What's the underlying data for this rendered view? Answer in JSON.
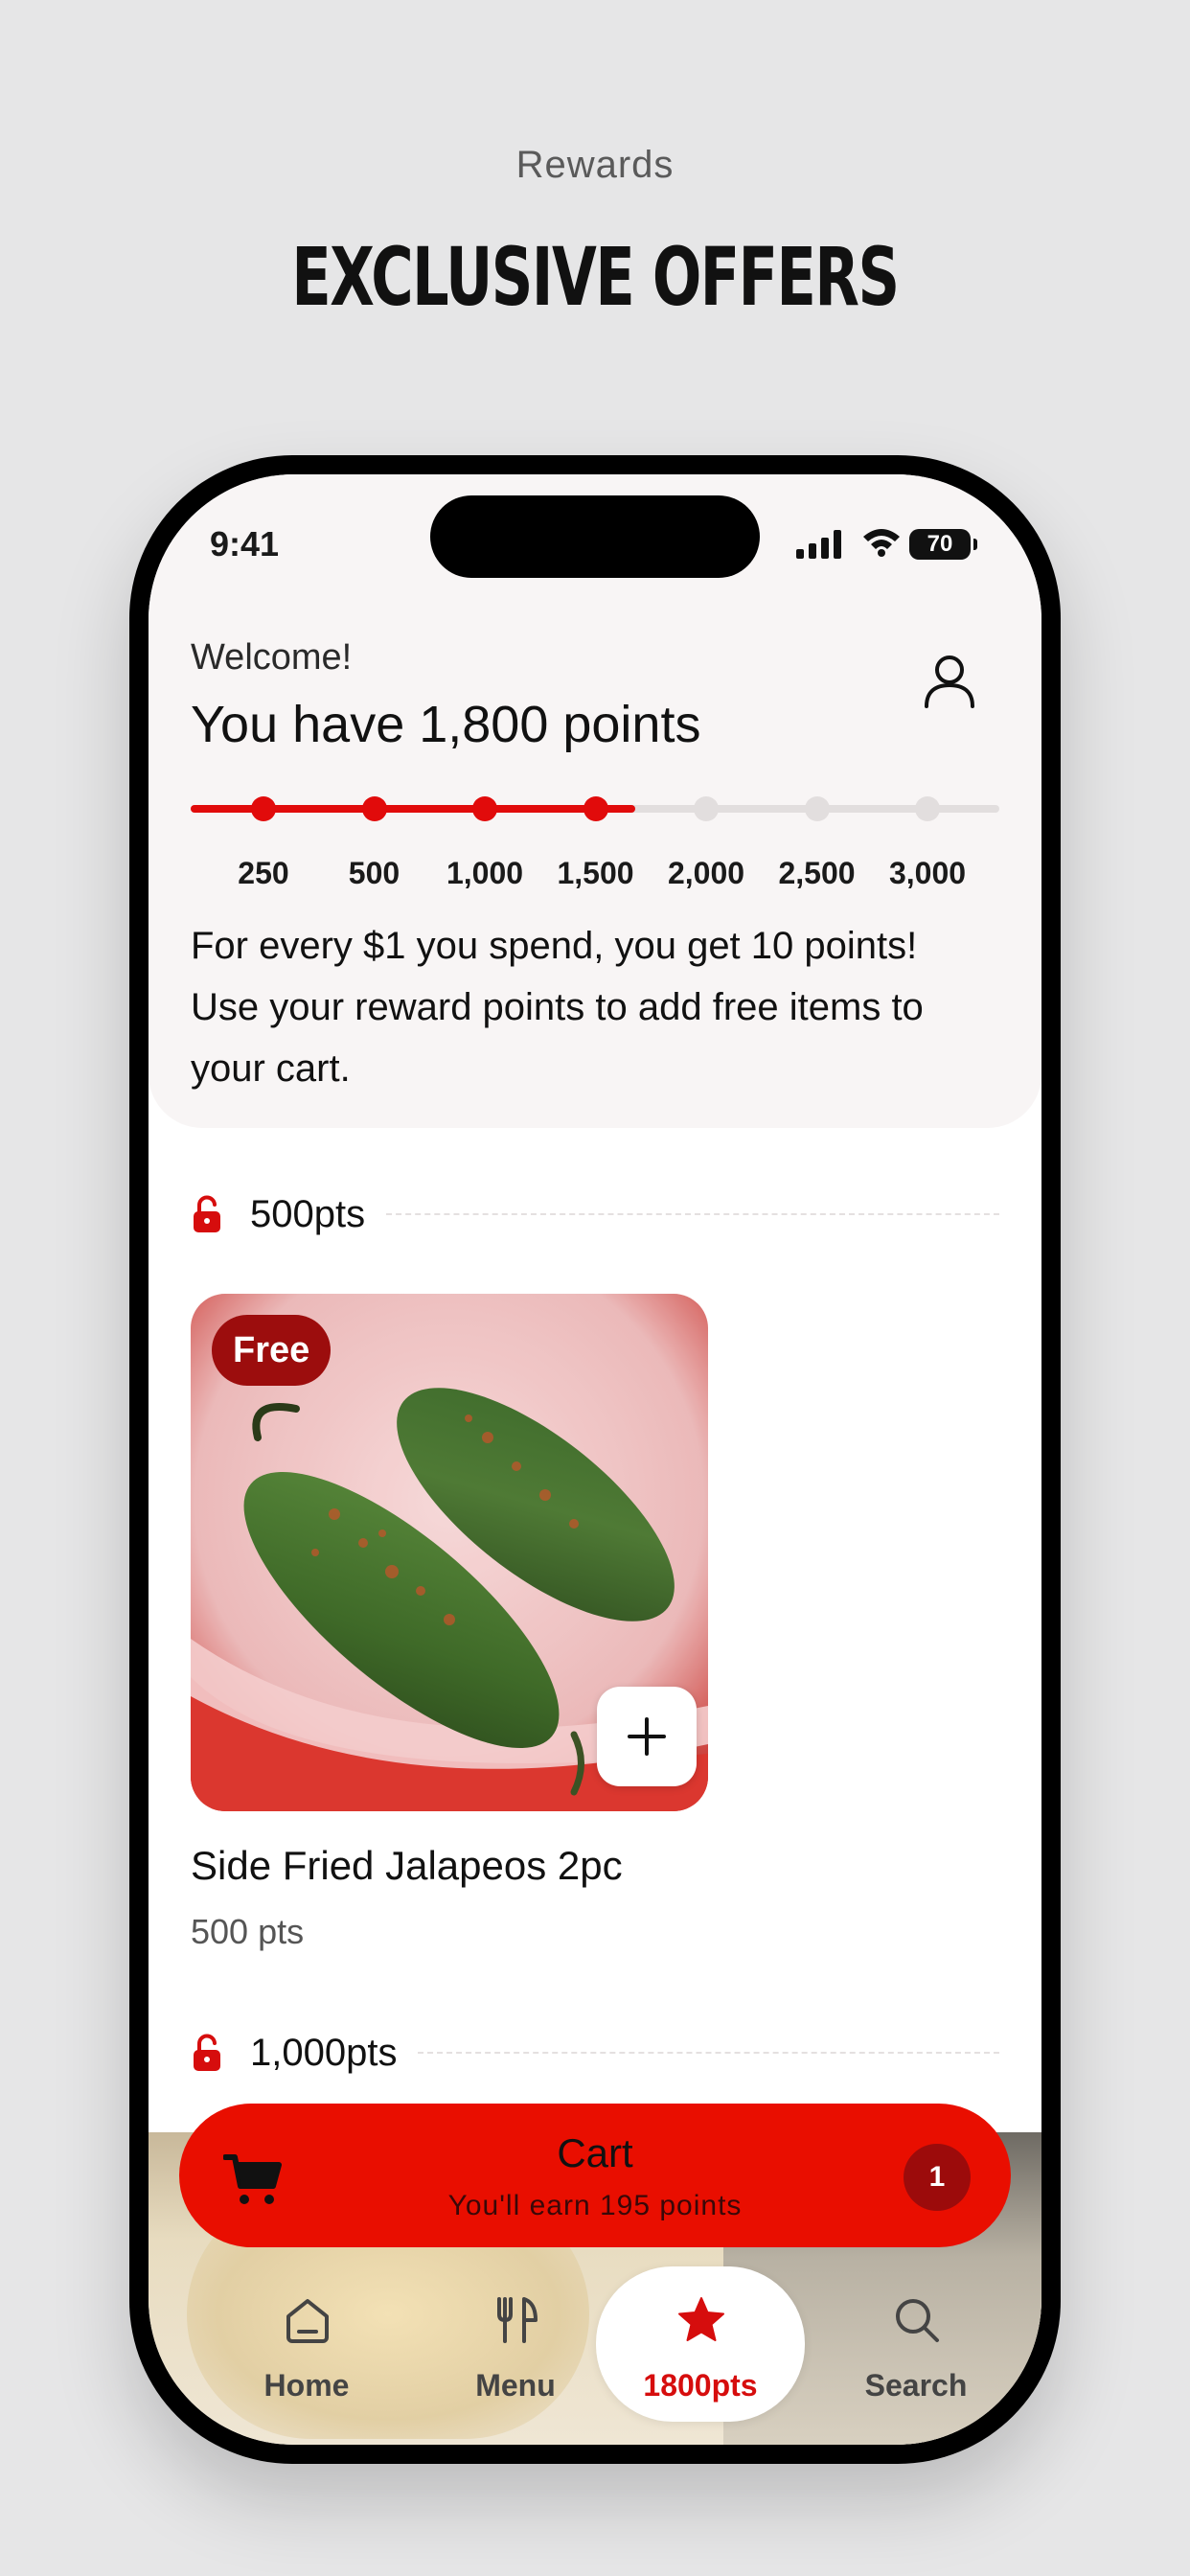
{
  "promo": {
    "subtitle": "Rewards",
    "title": "EXCLUSIVE OFFERS"
  },
  "status_bar": {
    "time": "9:41",
    "battery": "70"
  },
  "header": {
    "welcome": "Welcome!",
    "points_heading": "You have 1,800 points",
    "points_current": 1800,
    "info_text": "For every $1 you spend, you get 10 points! Use your reward points to add free items to your cart."
  },
  "progress": {
    "fill_fraction": 0.55,
    "milestones": [
      {
        "label": "250",
        "reached": true
      },
      {
        "label": "500",
        "reached": true
      },
      {
        "label": "1,000",
        "reached": true
      },
      {
        "label": "1,500",
        "reached": true
      },
      {
        "label": "2,000",
        "reached": false
      },
      {
        "label": "2,500",
        "reached": false
      },
      {
        "label": "3,000",
        "reached": false
      }
    ],
    "accent_color": "#e10b0b",
    "inactive_color": "#e2dede"
  },
  "tiers": [
    {
      "label": "500pts",
      "icon": "unlock-icon"
    },
    {
      "label": "1,000pts",
      "icon": "unlock-icon"
    }
  ],
  "product": {
    "badge": "Free",
    "name": "Side Fried Jalapeos 2pc",
    "points": "500 pts",
    "add_icon": "plus-icon"
  },
  "cart": {
    "title": "Cart",
    "subtitle": "You'll earn 195 points",
    "count": "1",
    "color": "#e90e00"
  },
  "tabs": [
    {
      "label": "Home",
      "icon": "home-icon"
    },
    {
      "label": "Menu",
      "icon": "fork-knife-icon"
    },
    {
      "label": "1800pts",
      "icon": "star-icon",
      "active": true
    },
    {
      "label": "Search",
      "icon": "search-icon"
    }
  ]
}
